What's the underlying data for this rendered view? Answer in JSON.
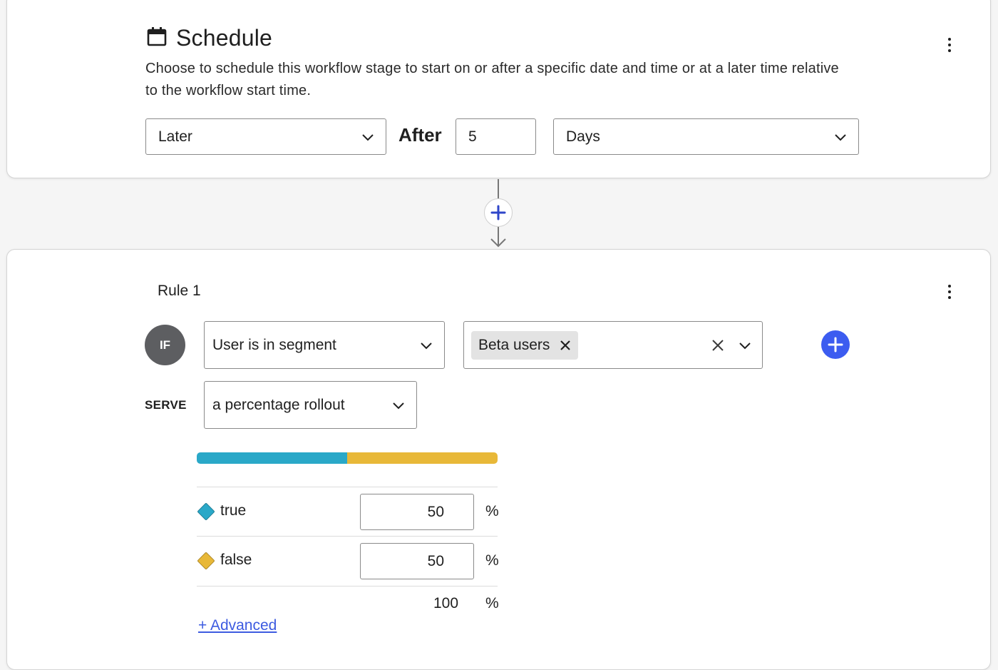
{
  "schedule": {
    "title": "Schedule",
    "icon": "calendar-icon",
    "description": "Choose to schedule this workflow stage to start on or after a specific date and time or at a later time relative to the workflow start time.",
    "timing_select": "Later",
    "after_label": "After",
    "amount_value": "5",
    "unit_select": "Days"
  },
  "connector": {
    "add_icon": "plus-icon",
    "accent_color": "#3c5cf0"
  },
  "rule": {
    "label": "Rule 1",
    "if_badge": "IF",
    "condition_select": "User is in segment",
    "segment_chip": "Beta users",
    "serve_label": "SERVE",
    "serve_select": "a percentage rollout",
    "variations": [
      {
        "name": "true",
        "percent": "50",
        "color": "#2aa8c8"
      },
      {
        "name": "false",
        "percent": "50",
        "color": "#e8b838"
      }
    ],
    "rollout_fractions": [
      0.5,
      0.5
    ],
    "percent_sign": "%",
    "total": "100",
    "advanced_link": "+ Advanced"
  }
}
